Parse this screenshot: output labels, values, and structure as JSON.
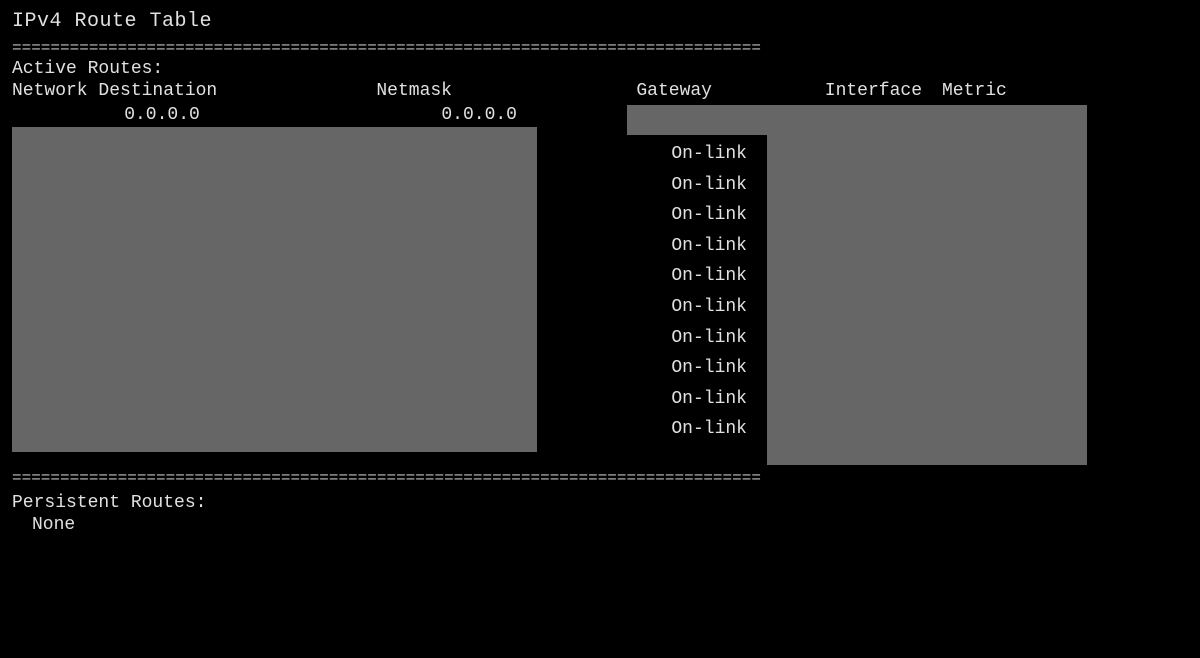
{
  "title": "IPv4 Route Table",
  "separator": "==============================================================================",
  "active_routes_label": "Active Routes:",
  "headers": {
    "network": "Network Destination",
    "netmask": "Netmask",
    "gateway": "Gateway",
    "interface": "Interface",
    "metric": "Metric"
  },
  "first_row": {
    "network": "0.0.0.0",
    "netmask": "0.0.0.0"
  },
  "gateway_entries": [
    "On-link",
    "On-link",
    "On-link",
    "On-link",
    "On-link",
    "On-link",
    "On-link",
    "On-link",
    "On-link",
    "On-link"
  ],
  "persistent_routes_label": "Persistent Routes:",
  "persistent_none": "None"
}
